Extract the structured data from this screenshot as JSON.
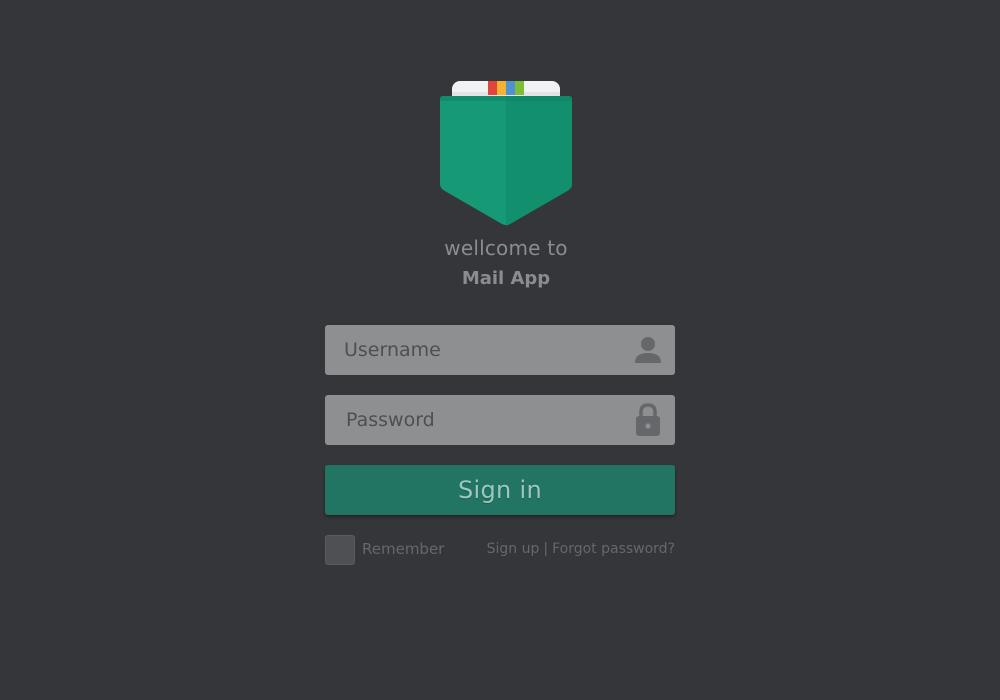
{
  "welcome": {
    "line1": "wellcome to",
    "app_name": "Mail App"
  },
  "form": {
    "username": {
      "placeholder": "Username",
      "value": "",
      "icon": "user-icon"
    },
    "password": {
      "placeholder": "Password",
      "value": "",
      "icon": "lock-icon"
    },
    "submit_label": "Sign in",
    "remember_label": "Remember",
    "remember_checked": false,
    "signup_label": "Sign up",
    "separator": "|",
    "forgot_label": "Forgot password?"
  },
  "logo": {
    "icon": "mail-pocket-logo-icon",
    "colors": {
      "pocket": "#169a76",
      "pocket_shade": "#128f6d",
      "card": "#f1f2f3",
      "stripes": [
        "#e2453c",
        "#f2b430",
        "#4e93cf",
        "#7dbd39"
      ]
    }
  },
  "colors": {
    "background": "#35363a",
    "input": "#8e8f91",
    "button": "#237563",
    "muted_text": "#66676b"
  }
}
